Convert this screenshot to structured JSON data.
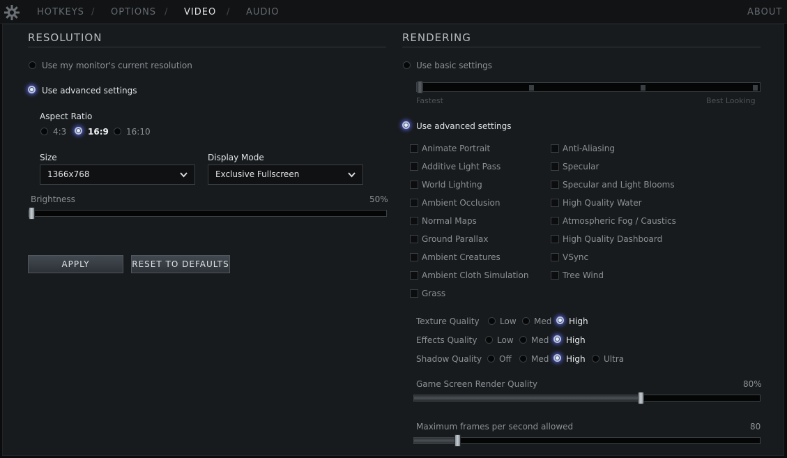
{
  "nav": {
    "hotkeys": "HOTKEYS",
    "options": "OPTIONS",
    "video": "VIDEO",
    "audio": "AUDIO",
    "about": "ABOUT",
    "sep": "/"
  },
  "resolution": {
    "title": "RESOLUTION",
    "monitor_label": "Use my monitor's current resolution",
    "advanced_label": "Use advanced settings",
    "selected_mode": "advanced",
    "aspect_ratio_label": "Aspect Ratio",
    "aspect_options": [
      "4:3",
      "16:9",
      "16:10"
    ],
    "aspect_selected": "16:9",
    "size_label": "Size",
    "size_value": "1366x768",
    "display_mode_label": "Display Mode",
    "display_mode_value": "Exclusive Fullscreen",
    "brightness_label": "Brightness",
    "brightness_value_text": "50%",
    "brightness_level": 0.0,
    "apply_label": "APPLY",
    "reset_label": "RESET TO DEFAULTS"
  },
  "rendering": {
    "title": "RENDERING",
    "basic_label": "Use basic settings",
    "fastest_label": "Fastest",
    "best_label": "Best Looking",
    "basic_level": 0.0,
    "advanced_label": "Use advanced settings",
    "selected_mode": "advanced",
    "checkboxes_left": [
      "Animate Portrait",
      "Additive Light Pass",
      "World Lighting",
      "Ambient Occlusion",
      "Normal Maps",
      "Ground Parallax",
      "Ambient Creatures",
      "Ambient Cloth Simulation",
      "Grass"
    ],
    "checkboxes_right": [
      "Anti-Aliasing",
      "Specular",
      "Specular and Light Blooms",
      "High Quality Water",
      "Atmospheric Fog / Caustics",
      "High Quality Dashboard",
      "VSync",
      "Tree Wind"
    ],
    "texture_quality_label": "Texture Quality",
    "texture_options": [
      "Low",
      "Med",
      "High"
    ],
    "texture_selected": "High",
    "effects_quality_label": "Effects Quality",
    "effects_options": [
      "Low",
      "Med",
      "High"
    ],
    "effects_selected": "High",
    "shadow_quality_label": "Shadow Quality",
    "shadow_options": [
      "Off",
      "Med",
      "High",
      "Ultra"
    ],
    "shadow_selected": "High",
    "render_quality_label": "Game Screen Render Quality",
    "render_quality_value_text": "80%",
    "render_quality_level": 0.66,
    "max_fps_label": "Maximum frames per second allowed",
    "max_fps_value_text": "80",
    "max_fps_level": 0.12
  },
  "colors": {
    "accent_glow": "#4b57c0",
    "panel_bg": "#181b1d",
    "active_nav": "#e4e7e9"
  },
  "icons": {
    "logo": "gear-logo-icon",
    "chevron": "chevron-down-icon"
  }
}
